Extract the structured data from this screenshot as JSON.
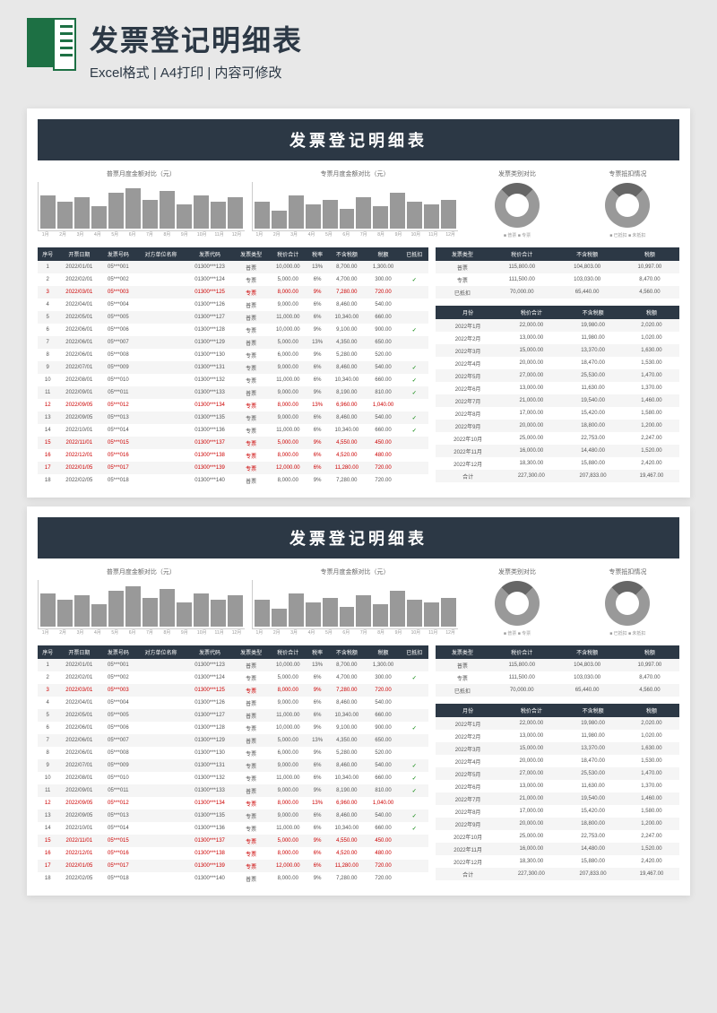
{
  "header": {
    "title": "发票登记明细表",
    "subtitle": "Excel格式 | A4打印 | 内容可修改"
  },
  "sheet": {
    "title": "发票登记明细表",
    "chart1_title": "普票月度金额对比（元）",
    "chart2_title": "专票月度金额对比（元）",
    "chart3_title": "发票类别对比",
    "chart4_title": "专票抵扣情况",
    "chart3_legend": "■ 普票 ■ 专票",
    "chart4_legend": "■ 已抵扣 ■ 未抵扣",
    "months": [
      "1月",
      "2月",
      "3月",
      "4月",
      "5月",
      "6月",
      "7月",
      "8月",
      "9月",
      "10月",
      "11月",
      "12月"
    ],
    "main_headers": [
      "序号",
      "开票日期",
      "发票号码",
      "对方单位名称",
      "发票代码",
      "发票类型",
      "税价合计",
      "税率",
      "不含税额",
      "税额",
      "已抵扣"
    ],
    "main_rows": [
      {
        "r": [
          "1",
          "2022/01/01",
          "05***001",
          "",
          "01300***123",
          "普票",
          "10,000.00",
          "13%",
          "8,700.00",
          "1,300.00",
          ""
        ],
        "red": false
      },
      {
        "r": [
          "2",
          "2022/02/01",
          "05***002",
          "",
          "01300***124",
          "专票",
          "5,000.00",
          "6%",
          "4,700.00",
          "300.00",
          "✓"
        ],
        "red": false
      },
      {
        "r": [
          "3",
          "2022/03/01",
          "05***003",
          "",
          "01300***125",
          "专票",
          "8,000.00",
          "9%",
          "7,280.00",
          "720.00",
          ""
        ],
        "red": true
      },
      {
        "r": [
          "4",
          "2022/04/01",
          "05***004",
          "",
          "01300***126",
          "普票",
          "9,000.00",
          "6%",
          "8,460.00",
          "540.00",
          ""
        ],
        "red": false
      },
      {
        "r": [
          "5",
          "2022/05/01",
          "05***005",
          "",
          "01300***127",
          "普票",
          "11,000.00",
          "6%",
          "10,340.00",
          "660.00",
          ""
        ],
        "red": false
      },
      {
        "r": [
          "6",
          "2022/06/01",
          "05***006",
          "",
          "01300***128",
          "专票",
          "10,000.00",
          "9%",
          "9,100.00",
          "900.00",
          "✓"
        ],
        "red": false
      },
      {
        "r": [
          "7",
          "2022/06/01",
          "05***007",
          "",
          "01300***129",
          "普票",
          "5,000.00",
          "13%",
          "4,350.00",
          "650.00",
          ""
        ],
        "red": false
      },
      {
        "r": [
          "8",
          "2022/06/01",
          "05***008",
          "",
          "01300***130",
          "专票",
          "6,000.00",
          "9%",
          "5,280.00",
          "520.00",
          ""
        ],
        "red": false
      },
      {
        "r": [
          "9",
          "2022/07/01",
          "05***009",
          "",
          "01300***131",
          "专票",
          "9,000.00",
          "6%",
          "8,460.00",
          "540.00",
          "✓"
        ],
        "red": false
      },
      {
        "r": [
          "10",
          "2022/08/01",
          "05***010",
          "",
          "01300***132",
          "专票",
          "11,000.00",
          "6%",
          "10,340.00",
          "660.00",
          "✓"
        ],
        "red": false
      },
      {
        "r": [
          "11",
          "2022/09/01",
          "05***011",
          "",
          "01300***133",
          "普票",
          "9,000.00",
          "9%",
          "8,190.00",
          "810.00",
          "✓"
        ],
        "red": false
      },
      {
        "r": [
          "12",
          "2022/09/05",
          "05***012",
          "",
          "01300***134",
          "专票",
          "8,000.00",
          "13%",
          "6,960.00",
          "1,040.00",
          ""
        ],
        "red": true
      },
      {
        "r": [
          "13",
          "2022/09/05",
          "05***013",
          "",
          "01300***135",
          "专票",
          "9,000.00",
          "6%",
          "8,460.00",
          "540.00",
          "✓"
        ],
        "red": false
      },
      {
        "r": [
          "14",
          "2022/10/01",
          "05***014",
          "",
          "01300***136",
          "专票",
          "11,000.00",
          "6%",
          "10,340.00",
          "660.00",
          "✓"
        ],
        "red": false
      },
      {
        "r": [
          "15",
          "2022/11/01",
          "05***015",
          "",
          "01300***137",
          "专票",
          "5,000.00",
          "9%",
          "4,550.00",
          "450.00",
          ""
        ],
        "red": true
      },
      {
        "r": [
          "16",
          "2022/12/01",
          "05***016",
          "",
          "01300***138",
          "专票",
          "8,000.00",
          "6%",
          "4,520.00",
          "480.00",
          ""
        ],
        "red": true
      },
      {
        "r": [
          "17",
          "2022/01/05",
          "05***017",
          "",
          "01300***139",
          "专票",
          "12,000.00",
          "6%",
          "11,280.00",
          "720.00",
          ""
        ],
        "red": true
      },
      {
        "r": [
          "18",
          "2022/02/05",
          "05***018",
          "",
          "01300***140",
          "普票",
          "8,000.00",
          "9%",
          "7,280.00",
          "720.00",
          ""
        ],
        "red": false
      }
    ],
    "type_headers": [
      "发票类型",
      "税价合计",
      "不含税额",
      "税额"
    ],
    "type_rows": [
      [
        "普票",
        "115,800.00",
        "104,803.00",
        "10,997.00"
      ],
      [
        "专票",
        "111,500.00",
        "103,030.00",
        "8,470.00"
      ],
      [
        "已抵扣",
        "70,000.00",
        "65,440.00",
        "4,560.00"
      ]
    ],
    "month_headers": [
      "月份",
      "税价合计",
      "不含税额",
      "税额"
    ],
    "month_rows": [
      [
        "2022年1月",
        "22,000.00",
        "19,980.00",
        "2,020.00"
      ],
      [
        "2022年2月",
        "13,000.00",
        "11,980.00",
        "1,020.00"
      ],
      [
        "2022年3月",
        "15,000.00",
        "13,370.00",
        "1,630.00"
      ],
      [
        "2022年4月",
        "20,000.00",
        "18,470.00",
        "1,530.00"
      ],
      [
        "2022年5月",
        "27,000.00",
        "25,530.00",
        "1,470.00"
      ],
      [
        "2022年6月",
        "13,000.00",
        "11,630.00",
        "1,370.00"
      ],
      [
        "2022年7月",
        "21,000.00",
        "19,540.00",
        "1,460.00"
      ],
      [
        "2022年8月",
        "17,000.00",
        "15,420.00",
        "1,580.00"
      ],
      [
        "2022年9月",
        "20,000.00",
        "18,800.00",
        "1,200.00"
      ],
      [
        "2022年10月",
        "25,000.00",
        "22,753.00",
        "2,247.00"
      ],
      [
        "2022年11月",
        "16,000.00",
        "14,480.00",
        "1,520.00"
      ],
      [
        "2022年12月",
        "18,300.00",
        "15,880.00",
        "2,420.00"
      ],
      [
        "合计",
        "227,300.00",
        "207,833.00",
        "19,467.00"
      ]
    ]
  },
  "chart_data": [
    {
      "type": "bar",
      "title": "普票月度金额对比（元）",
      "categories": [
        "1月",
        "2月",
        "3月",
        "4月",
        "5月",
        "6月",
        "7月",
        "8月",
        "9月",
        "10月",
        "11月",
        "12月"
      ],
      "values": [
        15000,
        12000,
        14000,
        10000,
        16000,
        18000,
        13000,
        17000,
        11000,
        15000,
        12000,
        14000
      ],
      "ylim": [
        0,
        20000
      ]
    },
    {
      "type": "bar",
      "title": "专票月度金额对比（元）",
      "categories": [
        "1月",
        "2月",
        "3月",
        "4月",
        "5月",
        "6月",
        "7月",
        "8月",
        "9月",
        "10月",
        "11月",
        "12月"
      ],
      "values": [
        12000,
        8000,
        15000,
        11000,
        13000,
        9000,
        14000,
        10000,
        16000,
        12000,
        11000,
        13000
      ],
      "ylim": [
        0,
        20000
      ]
    },
    {
      "type": "pie",
      "title": "发票类别对比",
      "series": [
        {
          "name": "普票",
          "value": 51
        },
        {
          "name": "专票",
          "value": 49
        }
      ]
    },
    {
      "type": "pie",
      "title": "专票抵扣情况",
      "series": [
        {
          "name": "已抵扣",
          "value": 63
        },
        {
          "name": "未抵扣",
          "value": 37
        }
      ]
    }
  ]
}
